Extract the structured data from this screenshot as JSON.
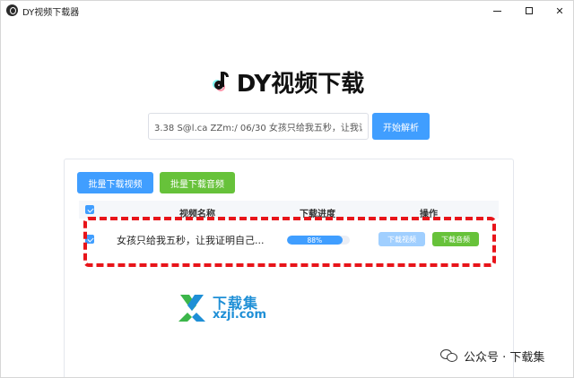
{
  "window": {
    "title": "DY视频下载器"
  },
  "header": {
    "title": "DY视频下载"
  },
  "search": {
    "value": "3.38 S@l.ca ZZm:/ 06/30 女孩只给我五秒，让我证明",
    "parse_label": "开始解析"
  },
  "toolbar": {
    "batch_video_label": "批量下载视频",
    "batch_audio_label": "批量下载音频"
  },
  "table": {
    "columns": [
      "视频名称",
      "下载进度",
      "操作"
    ],
    "rows": [
      {
        "name": "女孩只给我五秒，让我证明自己...",
        "progress_percent": 88,
        "progress_text": "88%",
        "video_label": "下载视频",
        "audio_label": "下载音频"
      }
    ]
  },
  "watermark": {
    "brand_cn": "下载集",
    "brand_url": "xzji.com"
  },
  "footer": {
    "wechat_label": "公众号 · 下载集"
  },
  "colors": {
    "primary": "#409eff",
    "success": "#67c23a",
    "highlight": "#e8141a"
  }
}
